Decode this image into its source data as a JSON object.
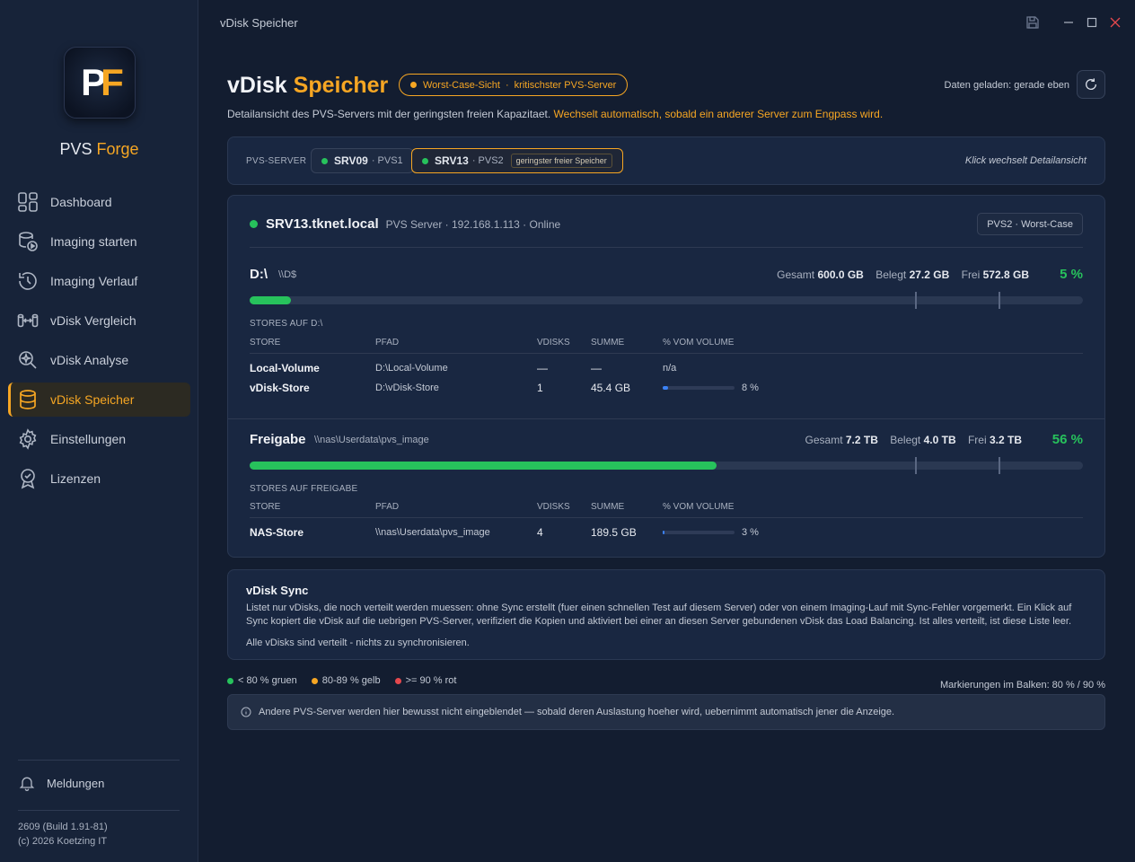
{
  "window": {
    "title": "vDisk Speicher"
  },
  "brand": {
    "logo": "PF",
    "name_part1": "PVS",
    "name_part2": "Forge"
  },
  "sidebar": {
    "items": [
      {
        "label": "Dashboard",
        "icon": "dashboard-icon"
      },
      {
        "label": "Imaging starten",
        "icon": "imaging-start-icon"
      },
      {
        "label": "Imaging Verlauf",
        "icon": "history-icon"
      },
      {
        "label": "vDisk Vergleich",
        "icon": "compare-icon"
      },
      {
        "label": "vDisk Analyse",
        "icon": "analyze-icon"
      },
      {
        "label": "vDisk Speicher",
        "icon": "database-icon",
        "active": true
      },
      {
        "label": "Einstellungen",
        "icon": "gear-icon"
      },
      {
        "label": "Lizenzen",
        "icon": "license-icon"
      }
    ],
    "notifications_label": "Meldungen",
    "version": "2609 (Build 1.91-81)",
    "copyright": "(c) 2026 Koetzing IT"
  },
  "header": {
    "title_part1": "vDisk",
    "title_part2": "Speicher",
    "badge_part1": "Worst-Case-Sicht",
    "badge_sep": "·",
    "badge_part2": "kritischster PVS-Server",
    "loaded": "Daten geladen: gerade eben",
    "subtitle_plain": "Detailansicht des PVS-Servers mit der geringsten freien Kapazitaet.",
    "subtitle_accent": "Wechselt automatisch, sobald ein anderer Server zum Engpass wird."
  },
  "server_selector": {
    "label": "PVS-SERVER",
    "servers": [
      {
        "name": "SRV09",
        "sub": "· PVS1"
      },
      {
        "name": "SRV13",
        "sub": "· PVS2",
        "tag": "geringster freier Speicher",
        "selected": true
      }
    ],
    "hint": "Klick wechselt Detailansicht"
  },
  "detail": {
    "host": "SRV13.tknet.local",
    "meta": "PVS Server · 192.168.1.113 · Online",
    "badge": "PVS2 · Worst-Case",
    "volumes": [
      {
        "name": "D:\\",
        "path": "\\\\D$",
        "gesamt_label": "Gesamt",
        "gesamt": "600.0 GB",
        "belegt_label": "Belegt",
        "belegt": "27.2 GB",
        "frei_label": "Frei",
        "frei": "572.8 GB",
        "pct": "5 %",
        "used_fraction": 0.05,
        "stores_label": "STORES AUF D:\\",
        "headers": [
          "STORE",
          "PFAD",
          "VDISKS",
          "SUMME",
          "% VOM VOLUME"
        ],
        "rows": [
          {
            "store": "Local-Volume",
            "path": "D:\\Local-Volume",
            "vdisks": "—",
            "summe": "—",
            "pct": "n/a",
            "bar": null
          },
          {
            "store": "vDisk-Store",
            "path": "D:\\vDisk-Store",
            "vdisks": "1",
            "summe": "45.4 GB",
            "pct": "8 %",
            "bar": 0.08
          }
        ]
      },
      {
        "name": "Freigabe",
        "path": "\\\\nas\\Userdata\\pvs_image",
        "gesamt_label": "Gesamt",
        "gesamt": "7.2 TB",
        "belegt_label": "Belegt",
        "belegt": "4.0 TB",
        "frei_label": "Frei",
        "frei": "3.2 TB",
        "pct": "56 %",
        "used_fraction": 0.56,
        "stores_label": "STORES AUF FREIGABE",
        "headers": [
          "STORE",
          "PFAD",
          "VDISKS",
          "SUMME",
          "% VOM VOLUME"
        ],
        "rows": [
          {
            "store": "NAS-Store",
            "path": "\\\\nas\\Userdata\\pvs_image",
            "vdisks": "4",
            "summe": "189.5 GB",
            "pct": "3 %",
            "bar": 0.03
          }
        ]
      }
    ]
  },
  "sync": {
    "title": "vDisk Sync",
    "description": "Listet nur vDisks, die noch verteilt werden muessen: ohne Sync erstellt (fuer einen schnellen Test auf diesem Server) oder von einem Imaging-Lauf mit Sync-Fehler vorgemerkt. Ein Klick auf Sync kopiert die vDisk auf die uebrigen PVS-Server, verifiziert die Kopien und aktiviert bei einer an diesen Server gebundenen vDisk das Load Balancing. Ist alles verteilt, ist diese Liste leer.",
    "status": "Alle vDisks sind verteilt - nichts zu synchronisieren."
  },
  "legend": {
    "items": [
      {
        "label": "< 80 % gruen",
        "color": "#27c25c"
      },
      {
        "label": "80-89 % gelb",
        "color": "#f6a623"
      },
      {
        "label": ">= 90 % rot",
        "color": "#e5484d"
      }
    ],
    "markings": "Markierungen im Balken: 80 % / 90 %",
    "marker_fractions": [
      0.8,
      0.9
    ]
  },
  "info": "Andere PVS-Server werden hier bewusst nicht eingeblendet — sobald deren Auslastung hoeher wird, uebernimmt automatisch jener die Anzeige.",
  "colors": {
    "accent": "#f6a623",
    "ok": "#27c25c",
    "bar_small": "#3b82f6"
  }
}
